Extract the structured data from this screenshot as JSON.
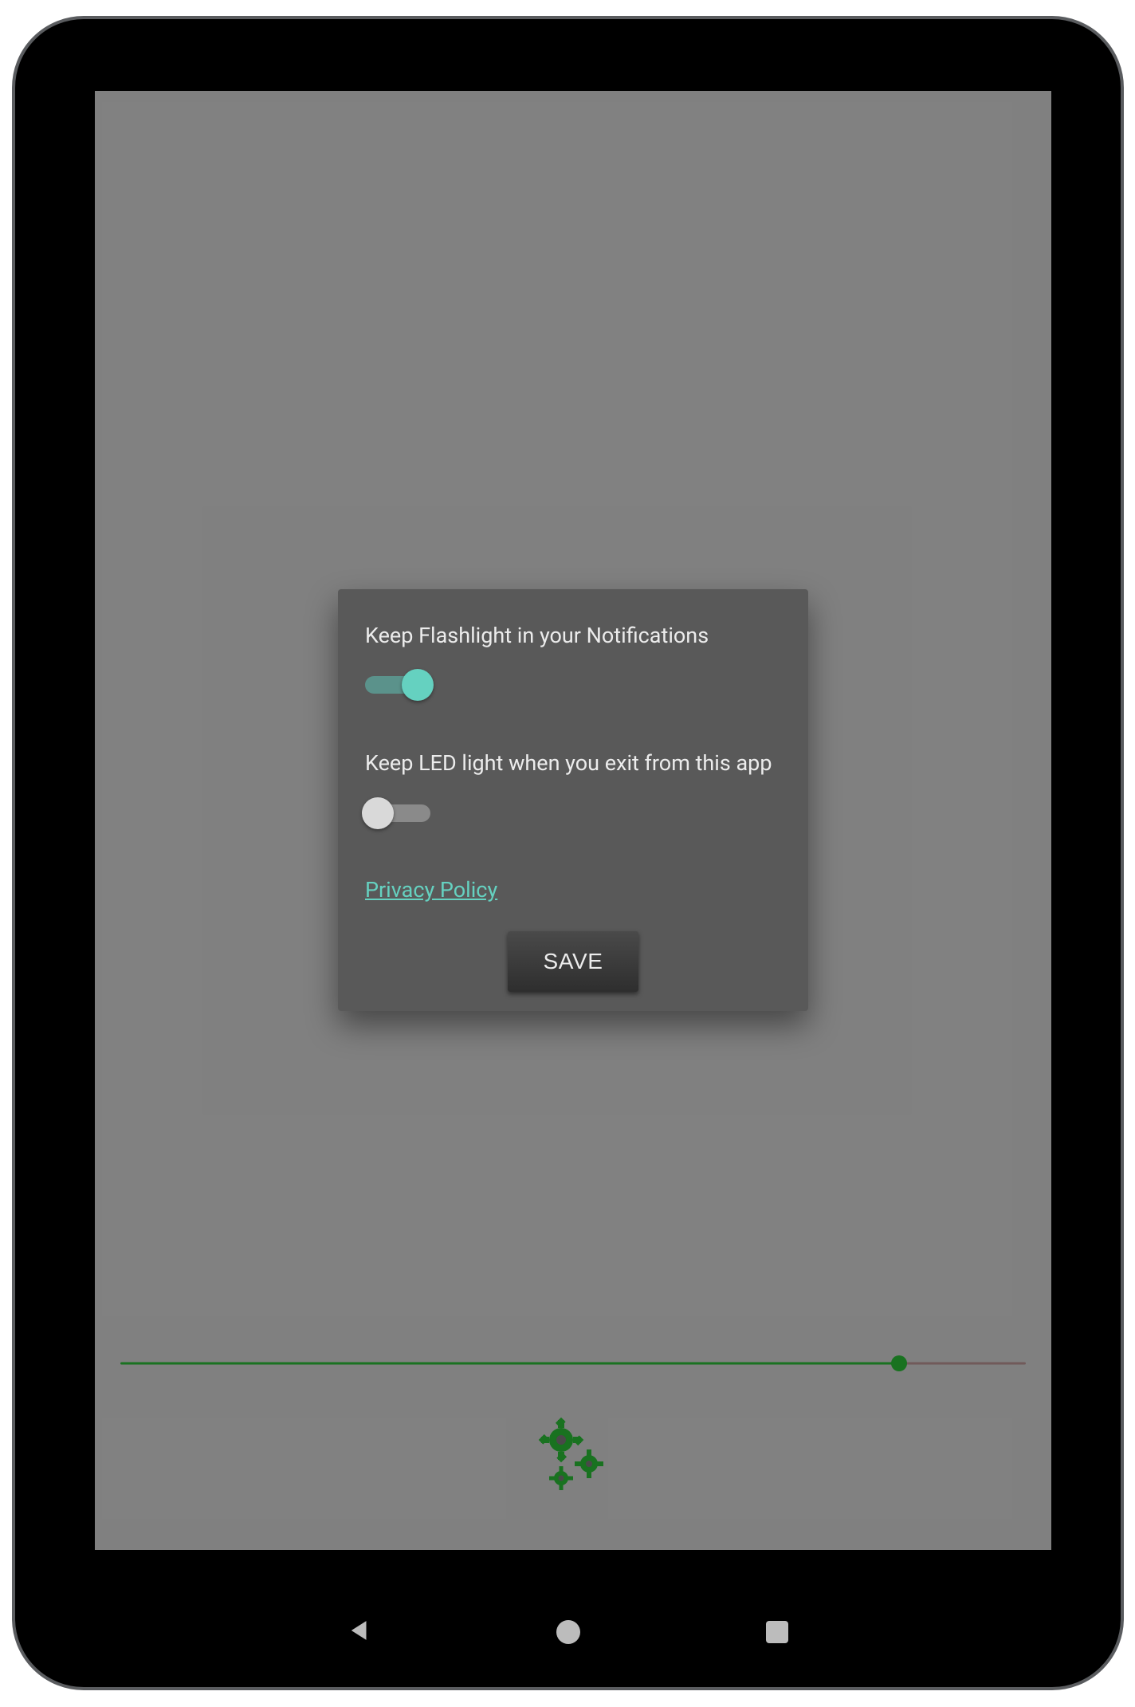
{
  "dialog": {
    "option1": {
      "label": "Keep Flashlight in your Notifications",
      "state": "on"
    },
    "option2": {
      "label": "Keep LED light when you exit from this app",
      "state": "off"
    },
    "privacy_link": "Privacy Policy",
    "save_label": "SAVE"
  },
  "slider": {
    "value_pct": 86
  }
}
